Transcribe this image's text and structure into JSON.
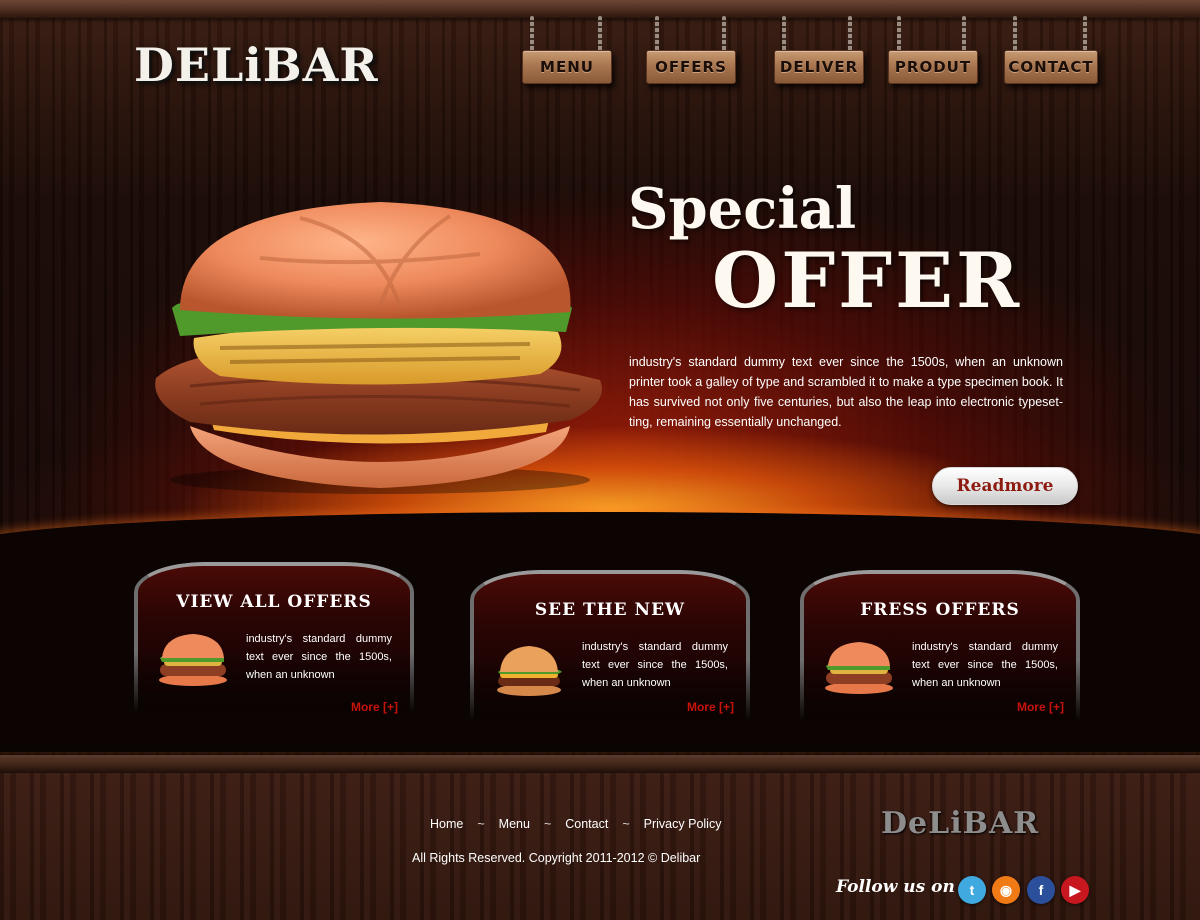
{
  "header": {
    "logo": "DELiBAR",
    "nav": [
      {
        "label": "MENU"
      },
      {
        "label": "OFFERS"
      },
      {
        "label": "DELIVER"
      },
      {
        "label": "PRODUT"
      },
      {
        "label": "CONTACT"
      }
    ]
  },
  "hero": {
    "title_line1": "Special",
    "title_line2": "OFFER",
    "text": "industry's standard dummy text ever since the 1500s, when an unknown printer took a galley of type and scrambled it to make a type specimen book. It has survived not only five centuries, but also the leap into electronic typeset-ting, remaining essentially unchanged.",
    "button_label": "Readmore"
  },
  "features": [
    {
      "title": "VIEW ALL OFFERS",
      "text": "industry's standard dummy text ever since the 1500s, when an unknown",
      "more": "More [+]"
    },
    {
      "title": "SEE THE NEW",
      "text": "industry's standard dummy text ever since the 1500s, when an unknown",
      "more": "More [+]"
    },
    {
      "title": "FRESS OFFERS",
      "text": "industry's standard dummy text ever since the 1500s, when an unknown",
      "more": "More [+]"
    }
  ],
  "footer": {
    "links": [
      "Home",
      "Menu",
      "Contact",
      "Privacy Policy"
    ],
    "separator": "~",
    "copyright": "All Rights Reserved. Copyright 2011-2012 ©  Delibar",
    "logo": "DeLiBAR",
    "follow_label": "Follow us on",
    "social": [
      {
        "name": "twitter-icon",
        "glyph": "t",
        "color": "#3fa9e0"
      },
      {
        "name": "rss-icon",
        "glyph": "◉",
        "color": "#f07b16"
      },
      {
        "name": "facebook-icon",
        "glyph": "f",
        "color": "#2c4f9c"
      },
      {
        "name": "youtube-icon",
        "glyph": "▶",
        "color": "#c8181f"
      }
    ]
  },
  "colors": {
    "accent_red": "#c8120c",
    "button_text": "#8e1b10",
    "wood": "#3a1d12"
  }
}
